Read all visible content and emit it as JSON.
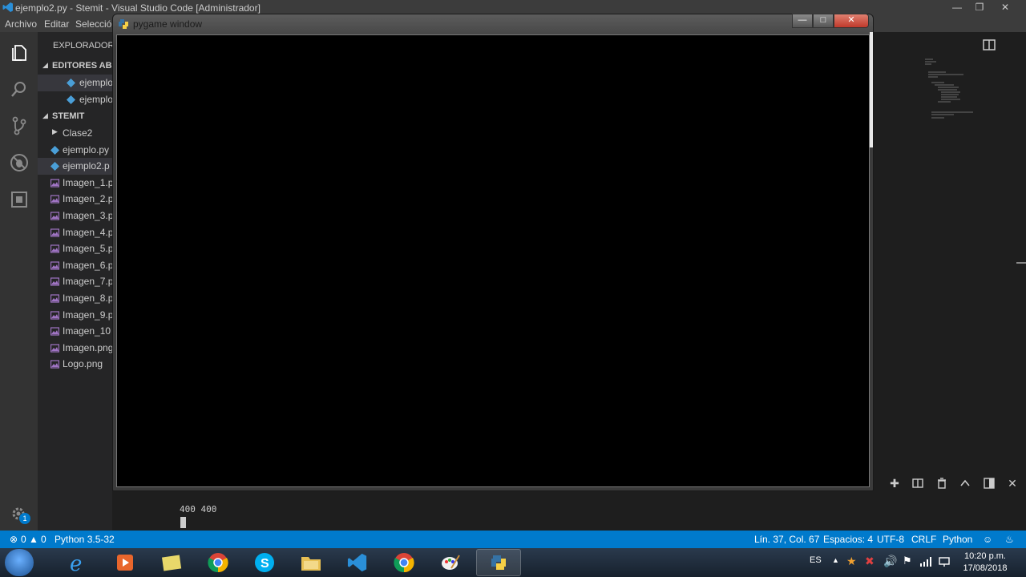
{
  "vscode": {
    "window_title": "ejemplo2.py - Stemit - Visual Studio Code [Administrador]",
    "menu": [
      "Archivo",
      "Editar",
      "Selecció"
    ],
    "sidebar": {
      "header": "EXPLORADOR",
      "open_editors_label": "EDITORES ABIE",
      "open_editors": [
        "ejemplo",
        "ejemplo"
      ],
      "project_label": "STEMIT",
      "tree": [
        {
          "label": "Clase2",
          "kind": "folder"
        },
        {
          "label": "ejemplo.py",
          "kind": "python"
        },
        {
          "label": "ejemplo2.p",
          "kind": "python",
          "selected": true
        },
        {
          "label": "Imagen_1.p",
          "kind": "image"
        },
        {
          "label": "Imagen_2.p",
          "kind": "image"
        },
        {
          "label": "Imagen_3.p",
          "kind": "image"
        },
        {
          "label": "Imagen_4.p",
          "kind": "image"
        },
        {
          "label": "Imagen_5.p",
          "kind": "image"
        },
        {
          "label": "Imagen_6.p",
          "kind": "image"
        },
        {
          "label": "Imagen_7.p",
          "kind": "image"
        },
        {
          "label": "Imagen_8.p",
          "kind": "image"
        },
        {
          "label": "Imagen_9.p",
          "kind": "image"
        },
        {
          "label": "Imagen_10",
          "kind": "image"
        },
        {
          "label": "Imagen.png",
          "kind": "image"
        },
        {
          "label": "Logo.png",
          "kind": "image"
        }
      ]
    },
    "activity_badge": "1",
    "terminal": {
      "output": "400 400"
    },
    "statusbar": {
      "errors": "0",
      "warnings": "0",
      "interpreter": "Python 3.5-32",
      "position": "Lín. 37, Col. 67",
      "spaces": "Espacios: 4",
      "encoding": "UTF-8",
      "eol": "CRLF",
      "language": "Python"
    }
  },
  "pygame": {
    "title": "pygame window"
  },
  "taskbar": {
    "language": "ES",
    "time": "10:20 p.m.",
    "date": "17/08/2018"
  },
  "colors": {
    "statusbar": "#007acc",
    "sidebar": "#252526",
    "activitybar": "#333333",
    "editor": "#1e1e1e"
  }
}
